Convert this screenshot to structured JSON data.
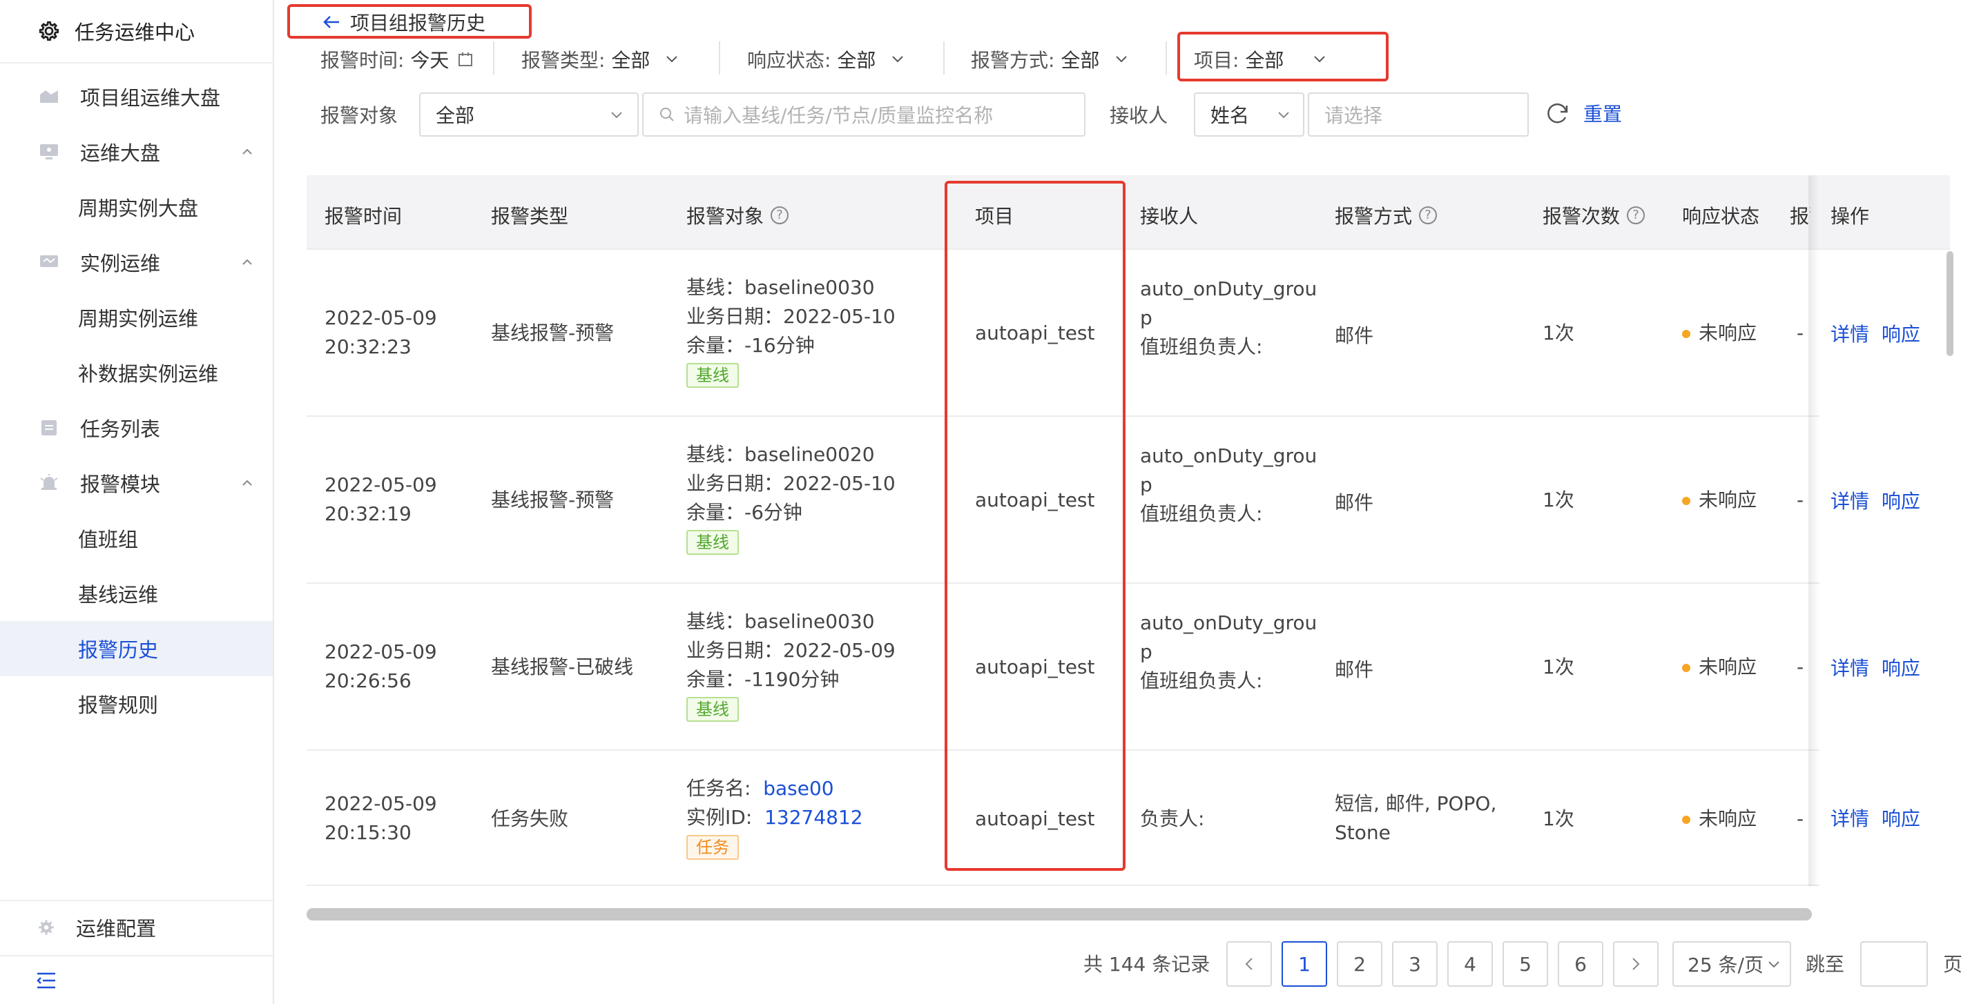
{
  "sidebar": {
    "title": "任务运维中心",
    "items": [
      {
        "label": "项目组运维大盘",
        "icon": "dashboard-icon"
      },
      {
        "label": "运维大盘",
        "icon": "monitor-icon",
        "expanded": true
      },
      {
        "label": "周期实例大盘"
      },
      {
        "label": "实例运维",
        "icon": "instance-icon",
        "expanded": true
      },
      {
        "label": "周期实例运维"
      },
      {
        "label": "补数据实例运维"
      },
      {
        "label": "任务列表",
        "icon": "list-icon"
      },
      {
        "label": "报警模块",
        "icon": "alarm-icon",
        "expanded": true
      },
      {
        "label": "值班组"
      },
      {
        "label": "基线运维"
      },
      {
        "label": "报警历史",
        "active": true
      },
      {
        "label": "报警规则"
      }
    ],
    "footer": "运维配置"
  },
  "header": {
    "back_label": "项目组报警历史"
  },
  "filters": {
    "alarm_time_label": "报警时间:",
    "alarm_time_value": "今天",
    "alarm_type_label": "报警类型:",
    "alarm_type_value": "全部",
    "response_status_label": "响应状态:",
    "response_status_value": "全部",
    "alarm_method_label": "报警方式:",
    "alarm_method_value": "全部",
    "project_label": "项目:",
    "project_value": "全部",
    "alarm_object_label": "报警对象",
    "alarm_object_value": "全部",
    "search_placeholder": "请输入基线/任务/节点/质量监控名称",
    "receiver_label": "接收人",
    "receiver_type_value": "姓名",
    "receiver_placeholder": "请选择",
    "reset_label": "重置"
  },
  "table": {
    "columns": [
      "报警时间",
      "报警类型",
      "报警对象",
      "项目",
      "接收人",
      "报警方式",
      "报警次数",
      "响应状态",
      "报警",
      "操作"
    ],
    "rows": [
      {
        "date": "2022-05-09",
        "time": "20:32:23",
        "type": "基线报警-预警",
        "obj_line1": "基线：baseline0030",
        "obj_line2": "业务日期：2022-05-10",
        "obj_line3": "余量：-16分钟",
        "tag": "基线",
        "project": "autoapi_test",
        "receiver_line1": "auto_onDuty_grou",
        "receiver_line2": "p",
        "receiver_line3": "值班组负责人:",
        "method": "邮件",
        "count": "1次",
        "status": "未响应",
        "extra": "-",
        "action_detail": "详情",
        "action_respond": "响应"
      },
      {
        "date": "2022-05-09",
        "time": "20:32:19",
        "type": "基线报警-预警",
        "obj_line1": "基线：baseline0020",
        "obj_line2": "业务日期：2022-05-10",
        "obj_line3": "余量：-6分钟",
        "tag": "基线",
        "project": "autoapi_test",
        "receiver_line1": "auto_onDuty_grou",
        "receiver_line2": "p",
        "receiver_line3": "值班组负责人:",
        "method": "邮件",
        "count": "1次",
        "status": "未响应",
        "extra": "-",
        "action_detail": "详情",
        "action_respond": "响应"
      },
      {
        "date": "2022-05-09",
        "time": "20:26:56",
        "type": "基线报警-已破线",
        "obj_line1": "基线：baseline0030",
        "obj_line2": "业务日期：2022-05-09",
        "obj_line3": "余量：-1190分钟",
        "tag": "基线",
        "project": "autoapi_test",
        "receiver_line1": "auto_onDuty_grou",
        "receiver_line2": "p",
        "receiver_line3": "值班组负责人:",
        "method": "邮件",
        "count": "1次",
        "status": "未响应",
        "extra": "-",
        "action_detail": "详情",
        "action_respond": "响应"
      },
      {
        "date": "2022-05-09",
        "time": "20:15:30",
        "type": "任务失败",
        "task_name_label": "任务名:",
        "task_name_value": "base00",
        "instance_label": "实例ID:",
        "instance_value": "13274812",
        "tag": "任务",
        "project": "autoapi_test",
        "receiver_line1": "负责人:",
        "method_line1": "短信, 邮件, POPO,",
        "method_line2": "Stone",
        "count": "1次",
        "status": "未响应",
        "extra": "-",
        "action_detail": "详情",
        "action_respond": "响应"
      }
    ]
  },
  "pagination": {
    "total": "共 144 条记录",
    "pages": [
      "1",
      "2",
      "3",
      "4",
      "5",
      "6"
    ],
    "current": "1",
    "page_size": "25 条/页",
    "jump_label": "跳至",
    "page_suffix": "页"
  },
  "colors": {
    "accent": "#1a4fd6",
    "highlight_box": "#e53a2f",
    "status_pending": "#f5a623"
  }
}
